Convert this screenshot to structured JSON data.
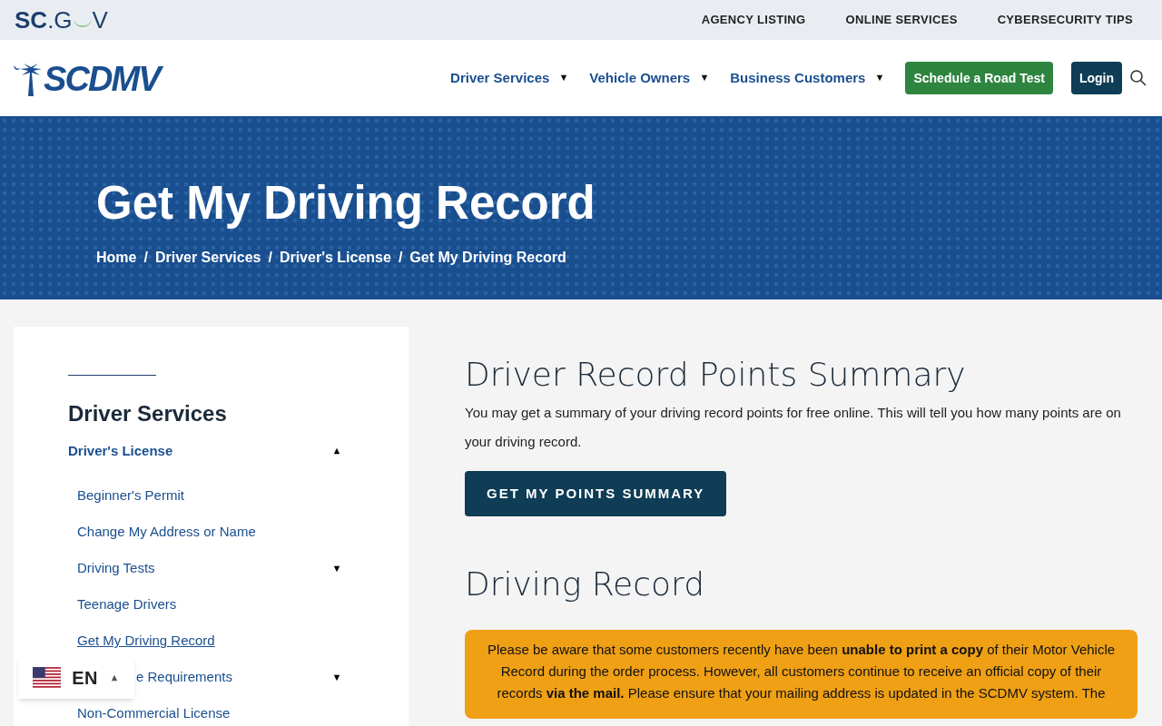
{
  "topbar": {
    "logo": {
      "left": "SC",
      ".G": ".G",
      "right": "V"
    },
    "links": [
      "AGENCY LISTING",
      "ONLINE SERVICES",
      "CYBERSECURITY TIPS"
    ]
  },
  "header": {
    "logo_text": "SCDMV",
    "nav": [
      {
        "label": "Driver Services",
        "kind": "dropdown"
      },
      {
        "label": "Vehicle Owners",
        "kind": "dropdown"
      },
      {
        "label": "Business Customers",
        "kind": "dropdown"
      },
      {
        "label": "Schedule a Road Test",
        "kind": "primary"
      },
      {
        "label": "Login",
        "kind": "dark"
      }
    ]
  },
  "hero": {
    "title": "Get My Driving Record",
    "breadcrumb_separator": "/",
    "breadcrumb": [
      {
        "label": "Home"
      },
      {
        "label": "Driver Services"
      },
      {
        "label": "Driver's License"
      },
      {
        "label": "Get My Driving Record"
      }
    ]
  },
  "sidebar": {
    "heading": "Driver Services",
    "section": {
      "label": "Driver's License",
      "expanded": true
    },
    "items": [
      {
        "label": "Beginner's Permit",
        "selected": false
      },
      {
        "label": "Change My Address or Name",
        "selected": false
      },
      {
        "label": "Driving Tests",
        "selected": false,
        "expanded": false
      },
      {
        "label": "Teenage Drivers",
        "selected": false
      },
      {
        "label": "Get My Driving Record",
        "selected": true
      },
      {
        "label": "e Requirements",
        "selected": false,
        "expanded": false
      },
      {
        "label": "Non-Commercial License",
        "selected": false
      }
    ]
  },
  "content": {
    "points": {
      "heading": "Driver Record Points Summary",
      "text": "You may get a summary of your driving record points for free online. This will tell you how many points are on your driving record.",
      "button": "GET MY POINTS SUMMARY"
    },
    "record": {
      "heading": "Driving Record",
      "notice": "Please be aware that some customers recently have been **unable to print a copy** of their Motor Vehicle Record during the order process. However, all customers continue to receive an official copy of their records **via the mail.** Please ensure that your mailing address is updated in the SCDMV system. The"
    }
  },
  "language": {
    "code": "EN",
    "open": false
  }
}
